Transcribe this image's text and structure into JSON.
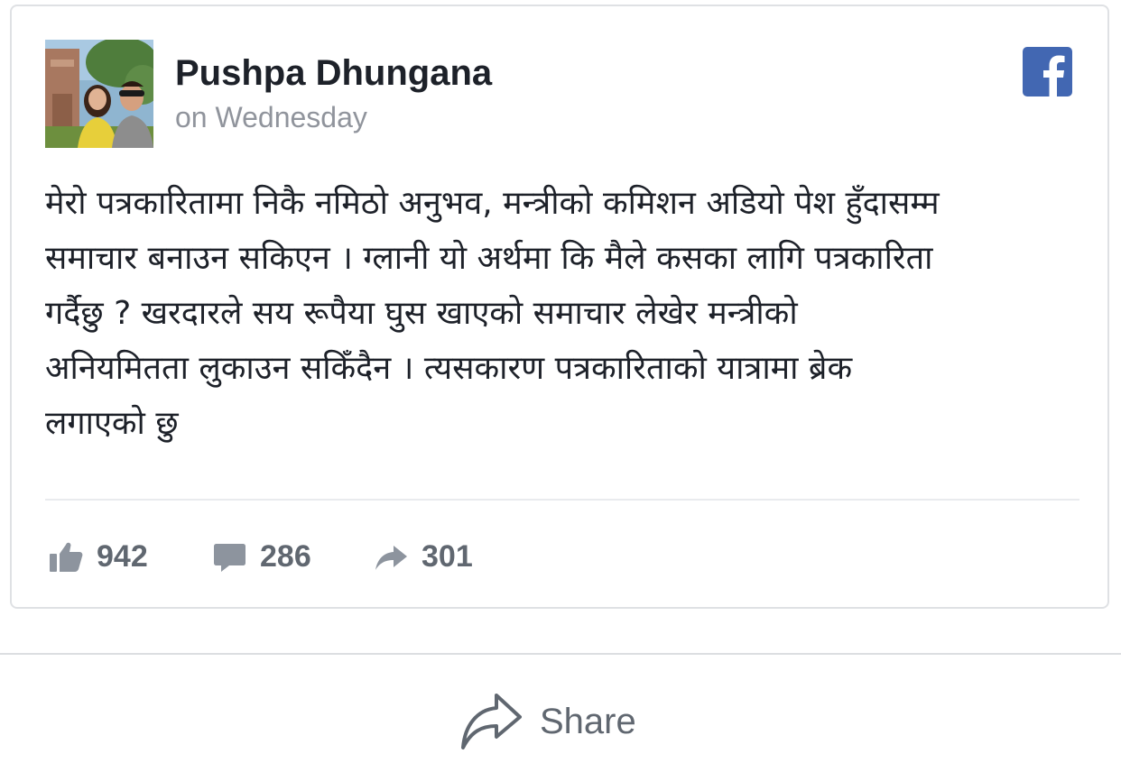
{
  "post": {
    "author_name": "Pushpa Dhungana",
    "timestamp": "on Wednesday",
    "avatar_icon": "profile-photo",
    "platform_icon": "facebook-icon",
    "text": "मेरो पत्रकारितामा निकै नमिठो अनुभव, मन्त्रीको कमिशन अडियो पेश हुँदासम्म\nसमाचार बनाउन सकिएन । ग्लानी यो अर्थमा कि मैले कसका लागि पत्रकारिता\nगर्दैछु ? खरदारले सय रूपैया घुस खाएको समाचार लेखेर मन्त्रीको\nअनियमितता लुकाउन सकिँदैन । त्यसकारण पत्रकारिताको यात्रामा ब्रेक\nलगाएको छु"
  },
  "stats": {
    "likes": "942",
    "comments": "286",
    "shares": "301",
    "likes_icon": "thumbs-up-icon",
    "comments_icon": "comment-bubble-icon",
    "shares_icon": "share-arrow-icon"
  },
  "footer": {
    "share_label": "Share",
    "share_icon": "share-arrow-outline-icon"
  },
  "colors": {
    "facebook_blue": "#4267b2",
    "text_primary": "#1d2129",
    "text_secondary": "#90949c",
    "stat_gray": "#606770"
  }
}
